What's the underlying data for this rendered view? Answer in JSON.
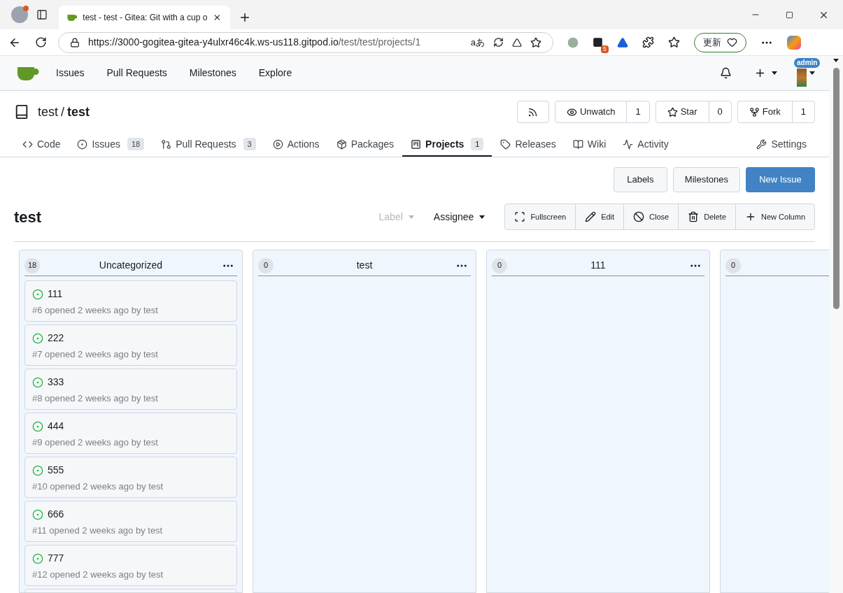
{
  "browser": {
    "tab_title": "test - test - Gitea: Git with a cup o",
    "url_host": "https://3000-gogitea-gitea-y4ulxr46c4k.ws-us118.gitpod.io",
    "url_path": "/test/test/projects/1",
    "translate_glyph": "aあ",
    "extension_badge": "5",
    "update_button": "更新"
  },
  "nav": {
    "items": [
      "Issues",
      "Pull Requests",
      "Milestones",
      "Explore"
    ],
    "avatar_badge": "admin"
  },
  "repo": {
    "owner": "test",
    "separator": "/",
    "name": "test",
    "actions": [
      {
        "label": "Unwatch",
        "count": "1"
      },
      {
        "label": "Star",
        "count": "0"
      },
      {
        "label": "Fork",
        "count": "1"
      }
    ]
  },
  "tabs": [
    {
      "label": "Code",
      "selected": false
    },
    {
      "label": "Issues",
      "count": "18",
      "selected": false
    },
    {
      "label": "Pull Requests",
      "count": "3",
      "selected": false
    },
    {
      "label": "Actions",
      "selected": false
    },
    {
      "label": "Packages",
      "selected": false
    },
    {
      "label": "Projects",
      "count": "1",
      "selected": true
    },
    {
      "label": "Releases",
      "selected": false
    },
    {
      "label": "Wiki",
      "selected": false
    },
    {
      "label": "Activity",
      "selected": false
    },
    {
      "label": "Settings",
      "selected": false
    }
  ],
  "page_buttons": [
    {
      "label": "Labels",
      "kind": "plain"
    },
    {
      "label": "Milestones",
      "kind": "plain"
    },
    {
      "label": "New Issue",
      "kind": "primary"
    }
  ],
  "project": {
    "title": "test",
    "filters": [
      {
        "label": "Label",
        "disabled": true
      },
      {
        "label": "Assignee",
        "disabled": false
      }
    ],
    "toolbar": [
      "Fullscreen",
      "Edit",
      "Close",
      "Delete",
      "New Column"
    ]
  },
  "columns": [
    {
      "count": "18",
      "title": "Uncategorized",
      "cards": [
        {
          "title": "111",
          "meta": "#6 opened 2 weeks ago by test"
        },
        {
          "title": "222",
          "meta": "#7 opened 2 weeks ago by test"
        },
        {
          "title": "333",
          "meta": "#8 opened 2 weeks ago by test"
        },
        {
          "title": "444",
          "meta": "#9 opened 2 weeks ago by test"
        },
        {
          "title": "555",
          "meta": "#10 opened 2 weeks ago by test"
        },
        {
          "title": "666",
          "meta": "#11 opened 2 weeks ago by test"
        },
        {
          "title": "777",
          "meta": "#12 opened 2 weeks ago by test"
        }
      ]
    },
    {
      "count": "0",
      "title": "test"
    },
    {
      "count": "0",
      "title": "111"
    },
    {
      "count": "0"
    }
  ]
}
